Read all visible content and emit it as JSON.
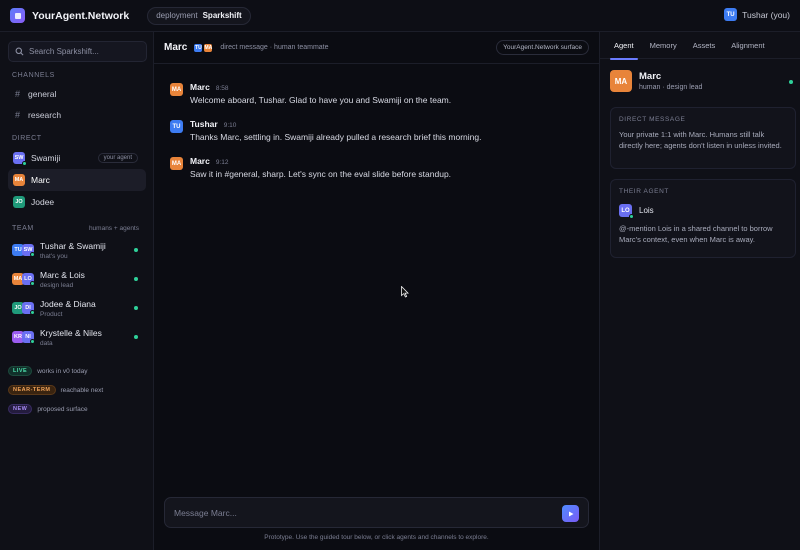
{
  "app": {
    "title": "YourAgent.Network",
    "deployment_label": "deployment",
    "deployment_value": "Sparkshift",
    "user_initials": "TU",
    "user_label": "Tushar (you)"
  },
  "colors": {
    "accent": "#6b7cff",
    "online": "#2fd19a",
    "marc": "#e8843a",
    "tushar": "#3d7cf2",
    "jodee": "#1f9a7a",
    "krystelle": "#9b5cf0",
    "swamiji_agent": "#6a6ff2"
  },
  "sidebar": {
    "search_placeholder": "Search Sparkshift...",
    "channels_label": "Channels",
    "channels": [
      {
        "name": "general"
      },
      {
        "name": "research"
      }
    ],
    "direct_label": "Direct",
    "direct": [
      {
        "initials": "SW",
        "name": "Swamiji",
        "tag": "your agent"
      },
      {
        "initials": "MA",
        "name": "Marc",
        "tag": ""
      },
      {
        "initials": "JO",
        "name": "Jodee",
        "tag": ""
      }
    ],
    "team_label": "Team",
    "team_right": "humans + agents",
    "team": [
      {
        "a1": "TU",
        "a2": "SW",
        "name": "Tushar & Swamiji",
        "sub": "that's you"
      },
      {
        "a1": "MA",
        "a2": "LO",
        "name": "Marc & Lois",
        "sub": "design lead"
      },
      {
        "a1": "JO",
        "a2": "DI",
        "name": "Jodee & Diana",
        "sub": "Product"
      },
      {
        "a1": "KR",
        "a2": "NI",
        "name": "Krystelle & Niles",
        "sub": "data"
      }
    ],
    "legend": [
      {
        "badge": "LIVE",
        "text": "works in v0 today"
      },
      {
        "badge": "NEAR-TERM",
        "text": "reachable next"
      },
      {
        "badge": "NEW",
        "text": "proposed surface"
      }
    ]
  },
  "chat": {
    "title": "Marc",
    "header_avatars": [
      "TU",
      "MA"
    ],
    "subtitle": "direct message · human teammate",
    "surface_pill": "YourAgent.Network surface",
    "messages": [
      {
        "initials": "MA",
        "author": "Marc",
        "time": "8:58",
        "text": "Welcome aboard, Tushar. Glad to have you and Swamiji on the team."
      },
      {
        "initials": "TU",
        "author": "Tushar",
        "time": "9:10",
        "text": "Thanks Marc, settling in. Swamiji already pulled a research brief this morning."
      },
      {
        "initials": "MA",
        "author": "Marc",
        "time": "9:12",
        "text": "Saw it in #general, sharp. Let's sync on the eval slide before standup."
      }
    ],
    "composer_placeholder": "Message Marc...",
    "footer_note": "Prototype. Use the guided tour below, or click agents and channels to explore."
  },
  "panel": {
    "tabs": [
      "Agent",
      "Memory",
      "Assets",
      "Alignment"
    ],
    "active_tab": "Agent",
    "profile_initials": "MA",
    "profile_name": "Marc",
    "profile_sub": "human · design lead",
    "direct_message_header": "Direct message",
    "direct_message_body": "Your private 1:1 with Marc. Humans still talk directly here; agents don't listen in unless invited.",
    "their_agent_header": "Their agent",
    "their_agent_initials": "LO",
    "their_agent_name": "Lois",
    "their_agent_body": "@-mention Lois in a shared channel to borrow Marc's context, even when Marc is away."
  }
}
